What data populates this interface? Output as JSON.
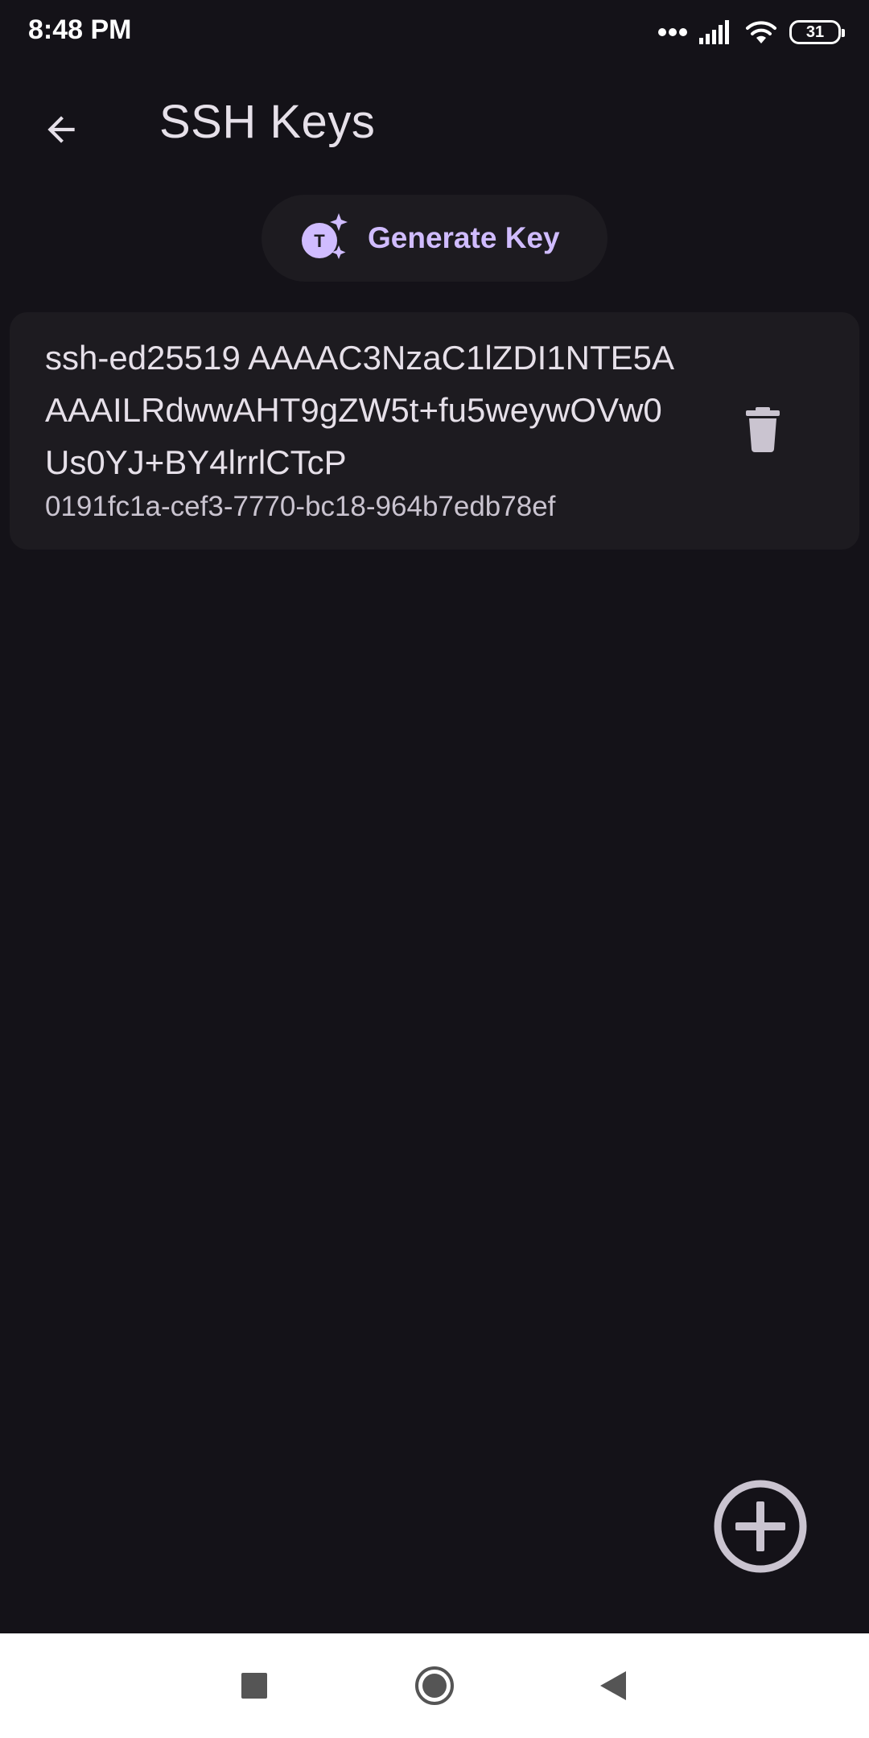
{
  "status_bar": {
    "time": "8:48 PM",
    "battery_level": "31",
    "icons": [
      "more-dots-icon",
      "cellular-signal-icon",
      "wifi-icon",
      "battery-icon"
    ]
  },
  "app_bar": {
    "title": "SSH Keys",
    "back_icon": "arrow-back-icon"
  },
  "generate_button": {
    "label": "Generate Key",
    "icon": "auto-awesome-icon"
  },
  "keys": [
    {
      "public_key": "ssh-ed25519 AAAAC3NzaC1lZDI1NTE5AAAAILRdwwAHT9gZW5t+fu5weywOVw0Us0YJ+BY4lrrlCTcP",
      "id": "0191fc1a-cef3-7770-bc18-964b7edb78ef",
      "delete_icon": "delete-icon"
    }
  ],
  "fab": {
    "icon": "add-circle-icon"
  },
  "nav_bar": {
    "icons": [
      "recents-square-icon",
      "home-circle-icon",
      "back-triangle-icon"
    ]
  },
  "colors": {
    "background": "#141218",
    "surface": "#1d1b20",
    "on_surface": "#e6e0e9",
    "on_surface_variant": "#cac4d0",
    "primary": "#d0bcff",
    "nav_bar": "#ffffff"
  }
}
